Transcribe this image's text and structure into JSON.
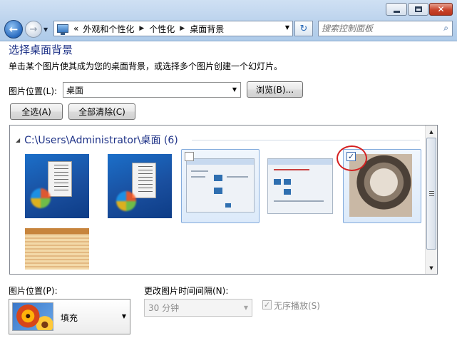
{
  "window": {
    "minimize": "minimize",
    "maximize": "maximize",
    "close": "✕"
  },
  "address": {
    "overflow": "«",
    "crumbs": [
      "外观和个性化",
      "个性化",
      "桌面背景"
    ]
  },
  "search": {
    "placeholder": "搜索控制面板"
  },
  "page": {
    "title": "选择桌面背景",
    "description": "单击某个图片使其成为您的桌面背景，或选择多个图片创建一个幻灯片。",
    "location_label": "图片位置(L):",
    "location_value": "桌面",
    "browse_button": "浏览(B)...",
    "select_all_button": "全选(A)",
    "clear_all_button": "全部清除(C)"
  },
  "gallery": {
    "group_title": "C:\\Users\\Administrator\\桌面 (6)",
    "items": [
      {
        "kind": "win7-desktop",
        "checked": false
      },
      {
        "kind": "win7-desktop",
        "checked": false
      },
      {
        "kind": "screenshot",
        "checked": false
      },
      {
        "kind": "screenshot",
        "checked": false
      },
      {
        "kind": "cat-photo",
        "checked": true
      },
      {
        "kind": "document",
        "checked": false
      }
    ]
  },
  "options": {
    "position_label": "图片位置(P):",
    "position_value": "填充",
    "interval_label": "更改图片时间间隔(N):",
    "interval_value": "30 分钟",
    "shuffle_label": "无序播放(S)",
    "shuffle_checked": true
  },
  "colors": {
    "title_blue": "#1e3287",
    "selection": "#dceafa",
    "highlight_ring": "#d42020"
  }
}
